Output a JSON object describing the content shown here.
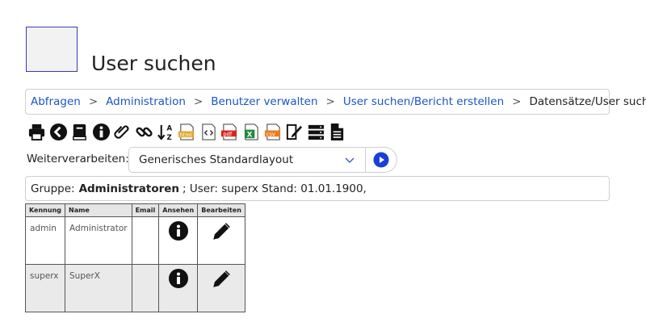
{
  "page": {
    "title": "User suchen"
  },
  "breadcrumb": {
    "items": [
      "Abfragen",
      "Administration",
      "Benutzer verwalten",
      "User suchen/Bericht erstellen"
    ],
    "separator": ">",
    "current": "Datensätze/User suchen"
  },
  "toolbar": {
    "icons": [
      "print-icon",
      "back-icon",
      "book-icon",
      "info-icon",
      "paperclip-icon",
      "link-icon",
      "sort-alpha-icon",
      "html-export-icon",
      "code-export-icon",
      "pdf-export-icon",
      "excel-export-icon",
      "csv-export-icon",
      "edit-document-icon",
      "server-icon",
      "document-icon"
    ],
    "badges": {
      "html": "html",
      "pdf": "pdf",
      "xls": "X",
      "csv": "csv"
    }
  },
  "weiterverarbeiten": {
    "label": "Weiterverarbeiten:",
    "selected": "Generisches Standardlayout"
  },
  "info": {
    "group_label": "Gruppe:",
    "group_value": "Administratoren",
    "rest": "; User: superx Stand: 01.01.1900,"
  },
  "table": {
    "headers": [
      "Kennung",
      "Name",
      "Email",
      "Ansehen",
      "Bearbeiten"
    ],
    "rows": [
      {
        "kennung": "admin",
        "name": "Administrator",
        "email": ""
      },
      {
        "kennung": "superx",
        "name": "SuperX",
        "email": ""
      }
    ]
  },
  "colors": {
    "link": "#1a56c4",
    "accent": "#1a3fd8"
  }
}
